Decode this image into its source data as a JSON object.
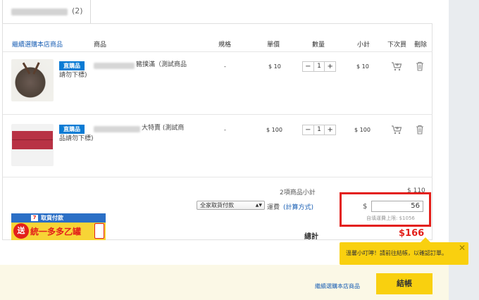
{
  "tab": {
    "count": "(2)"
  },
  "table": {
    "continue_shopping": "繼續選購本店商品",
    "headers": [
      "商品",
      "規格",
      "單價",
      "數量",
      "小計",
      "下次買",
      "刪除"
    ]
  },
  "items": [
    {
      "badge": "直購品",
      "name": "豬撲滿（測試商品請勿下標)",
      "name_line1": "豬撲滿（測試商品",
      "name_line2": "請勿下標)",
      "spec": "-",
      "price": "$ 10",
      "qty": "1",
      "subtotal": "$ 10",
      "minus": "−",
      "plus": "+"
    },
    {
      "badge": "直購品",
      "name": "大特賣 (測試商品請勿下標)",
      "name_line1": "大特賣 (測試商",
      "name_line2": "品請勿下標)",
      "spec": "-",
      "price": "$ 100",
      "qty": "1",
      "subtotal": "$ 100",
      "minus": "−",
      "plus": "+"
    }
  ],
  "summary": {
    "items_subtotal_label": "2項商品小計",
    "items_subtotal_value": "$ 110",
    "shipping_method": "全家取貨付款",
    "shipping_label": "運費",
    "calc_link": "(計算方式)",
    "currency_symbol": "$",
    "shipping_fee": "56",
    "shipping_limit": "自填運費上限: $1056",
    "total_label": "總計",
    "total_value": "$166"
  },
  "banner": {
    "logo": "7",
    "top_text": "取貨付款",
    "send": "送",
    "promo": "統一多多乙罐"
  },
  "tooltip": {
    "text": "溫馨小叮嚀！請前往結帳，以確認訂單。",
    "close": "✕"
  },
  "footer": {
    "continue_shopping": "繼續選購本店商品",
    "checkout": "結帳"
  },
  "colors": {
    "accent_blue": "#0a7bd4",
    "link_blue": "#1a5fb4",
    "highlight_red": "#e3201b",
    "checkout_yellow": "#f9d00f"
  }
}
